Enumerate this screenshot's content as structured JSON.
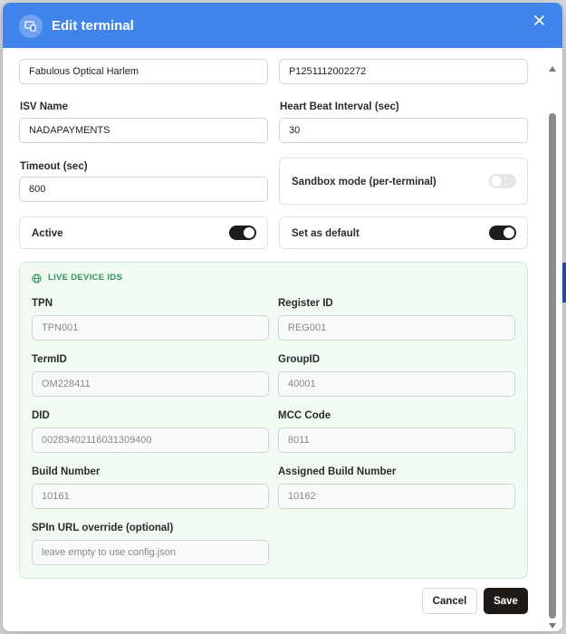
{
  "modal": {
    "title": "Edit terminal"
  },
  "fields": {
    "merchant_name": "Fabulous Optical Harlem",
    "serial_number": "P1251112002272",
    "isv_name": {
      "label": "ISV Name",
      "value": "NADAPAYMENTS"
    },
    "heartbeat": {
      "label": "Heart Beat Interval (sec)",
      "value": "30"
    },
    "timeout": {
      "label": "Timeout (sec)",
      "value": "600"
    }
  },
  "toggles": {
    "sandbox": {
      "label": "Sandbox mode (per-terminal)",
      "on": false
    },
    "active": {
      "label": "Active",
      "on": true
    },
    "default": {
      "label": "Set as default",
      "on": true
    }
  },
  "live_device": {
    "title": "LIVE DEVICE IDS",
    "tpn": {
      "label": "TPN",
      "placeholder": "TPN001"
    },
    "register_id": {
      "label": "Register ID",
      "placeholder": "REG001"
    },
    "term_id": {
      "label": "TermID",
      "placeholder": "OM228411"
    },
    "group_id": {
      "label": "GroupID",
      "placeholder": "40001"
    },
    "did": {
      "label": "DID",
      "placeholder": "00283402116031309400"
    },
    "mcc": {
      "label": "MCC Code",
      "placeholder": "8011"
    },
    "build_number": {
      "label": "Build Number",
      "placeholder": "10161"
    },
    "assigned_build": {
      "label": "Assigned Build Number",
      "placeholder": "10162"
    },
    "spin_url": {
      "label": "SPIn URL override (optional)",
      "placeholder": "leave empty to use config.json"
    }
  },
  "actions": {
    "cancel": "Cancel",
    "save": "Save"
  },
  "colors": {
    "header": "#3f84ea",
    "save_button": "#1f1a17",
    "live_panel_bg": "#f1fbf4",
    "live_title": "#2f9455"
  }
}
